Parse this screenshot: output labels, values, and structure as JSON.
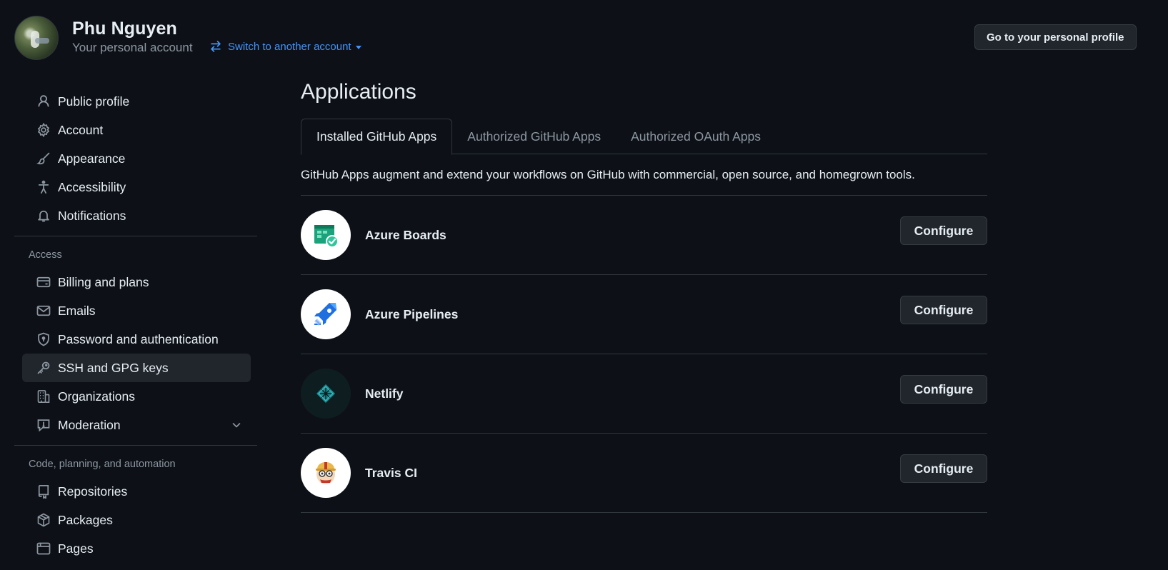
{
  "header": {
    "user_name": "Phu Nguyen",
    "user_sub": "Your personal account",
    "switch_label": "Switch to another account",
    "profile_button": "Go to your personal profile"
  },
  "sidebar": {
    "items_top": [
      {
        "label": "Public profile",
        "icon": "person-icon"
      },
      {
        "label": "Account",
        "icon": "gear-icon"
      },
      {
        "label": "Appearance",
        "icon": "paintbrush-icon"
      },
      {
        "label": "Accessibility",
        "icon": "accessibility-icon"
      },
      {
        "label": "Notifications",
        "icon": "bell-icon"
      }
    ],
    "access_label": "Access",
    "items_access": [
      {
        "label": "Billing and plans",
        "icon": "credit-card-icon"
      },
      {
        "label": "Emails",
        "icon": "mail-icon"
      },
      {
        "label": "Password and authentication",
        "icon": "shield-lock-icon"
      },
      {
        "label": "SSH and GPG keys",
        "icon": "key-icon",
        "active": true
      },
      {
        "label": "Organizations",
        "icon": "organization-icon"
      },
      {
        "label": "Moderation",
        "icon": "report-icon",
        "expandable": true
      }
    ],
    "code_label": "Code, planning, and automation",
    "items_code": [
      {
        "label": "Repositories",
        "icon": "repo-icon"
      },
      {
        "label": "Packages",
        "icon": "package-icon"
      },
      {
        "label": "Pages",
        "icon": "browser-icon"
      }
    ]
  },
  "main": {
    "title": "Applications",
    "tabs": [
      {
        "label": "Installed GitHub Apps",
        "active": true
      },
      {
        "label": "Authorized GitHub Apps"
      },
      {
        "label": "Authorized OAuth Apps"
      }
    ],
    "intro": "GitHub Apps augment and extend your workflows on GitHub with commercial, open source, and homegrown tools.",
    "apps": [
      {
        "name": "Azure Boards",
        "icon": "azure-boards-logo",
        "button": "Configure"
      },
      {
        "name": "Azure Pipelines",
        "icon": "azure-pipelines-logo",
        "button": "Configure"
      },
      {
        "name": "Netlify",
        "icon": "netlify-logo",
        "button": "Configure"
      },
      {
        "name": "Travis CI",
        "icon": "travis-ci-logo",
        "button": "Configure"
      }
    ]
  },
  "colors": {
    "background": "#0d1117",
    "text": "#e6edf3",
    "muted": "#8d96a0",
    "link": "#4493f8",
    "border": "#30363d",
    "button_bg": "#21262d"
  }
}
